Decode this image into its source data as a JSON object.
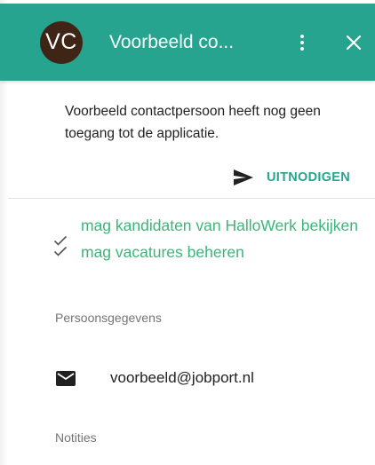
{
  "header": {
    "avatar_initials": "VC",
    "title": "Voorbeeld co...",
    "background": "#26a48f",
    "more_icon": "more-vert-icon",
    "close_icon": "close-icon"
  },
  "invite": {
    "message": "Voorbeeld contactpersoon heeft nog geen toegang tot de applicatie.",
    "button_label": "UITNODIGEN",
    "button_icon": "send-icon"
  },
  "permissions": [
    {
      "label": "mag kandidaten van HalloWerk bekijken"
    },
    {
      "label": "mag vacatures beheren"
    }
  ],
  "personal": {
    "section_label": "Persoonsgegevens",
    "email_icon": "mail-icon",
    "email": "voorbeeld@jobport.nl"
  },
  "notes": {
    "section_label": "Notities"
  },
  "colors": {
    "accent": "#26a48f",
    "permission_text": "#3bb67a",
    "avatar": "#3e2516"
  }
}
